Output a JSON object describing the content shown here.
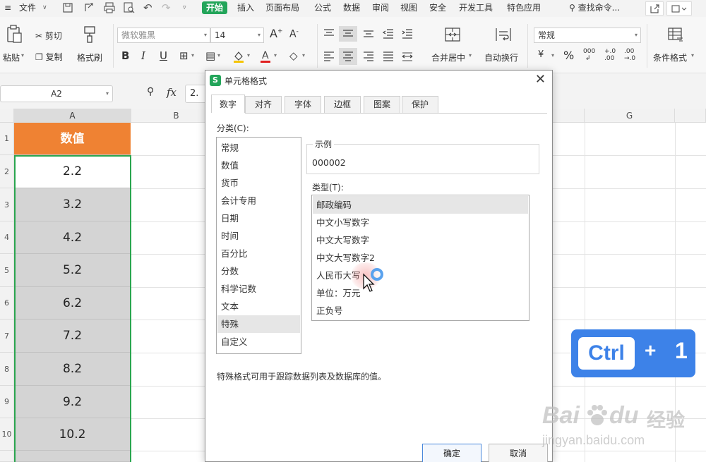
{
  "menubar": {
    "items": [
      "文件",
      "开始",
      "插入",
      "页面布局",
      "公式",
      "数据",
      "审阅",
      "视图",
      "安全",
      "开发工具",
      "特色应用"
    ],
    "search": "查找命令..."
  },
  "ribbon": {
    "paste": "粘贴",
    "cut": "剪切",
    "copy": "复制",
    "format_painter": "格式刷",
    "font_name": "微软雅黑",
    "font_size": "14",
    "merge_center": "合并居中",
    "wrap_text": "自动换行",
    "number_format": "常规",
    "conditional_format": "条件格式"
  },
  "formula_bar": {
    "name_box": "A2",
    "fx": "fx",
    "value": "2."
  },
  "sheet": {
    "columns": [
      "A",
      "B",
      "G"
    ],
    "rows": [
      "1",
      "2",
      "3",
      "4",
      "5",
      "6",
      "7",
      "8",
      "9",
      "10"
    ],
    "header_cell": "数值",
    "values": [
      "2.2",
      "3.2",
      "4.2",
      "5.2",
      "6.2",
      "7.2",
      "8.2",
      "9.2",
      "10.2"
    ]
  },
  "dialog": {
    "title": "单元格格式",
    "tabs": [
      "数字",
      "对齐",
      "字体",
      "边框",
      "图案",
      "保护"
    ],
    "category_label": "分类(C):",
    "categories": [
      "常规",
      "数值",
      "货币",
      "会计专用",
      "日期",
      "时间",
      "百分比",
      "分数",
      "科学记数",
      "文本",
      "特殊",
      "自定义"
    ],
    "sample_label": "示例",
    "sample_value": "000002",
    "type_label": "类型(T):",
    "types": [
      "邮政编码",
      "中文小写数字",
      "中文大写数字",
      "中文大写数字2",
      "人民币大写",
      "单位：万元",
      "正负号"
    ],
    "description": "特殊格式可用于跟踪数据列表及数据库的值。",
    "ok": "确定",
    "cancel": "取消"
  },
  "shortcut": {
    "key": "Ctrl",
    "plus": "+",
    "num": "1"
  },
  "watermark": {
    "brand": "Bai",
    "brand2": "du",
    "cn": "经验",
    "url": "jingyan.baidu.com"
  },
  "colors": {
    "accent_green": "#23a55a",
    "header_orange": "#ef8233",
    "selection_green": "#2aa54f",
    "shortcut_blue": "#3d82e8"
  }
}
